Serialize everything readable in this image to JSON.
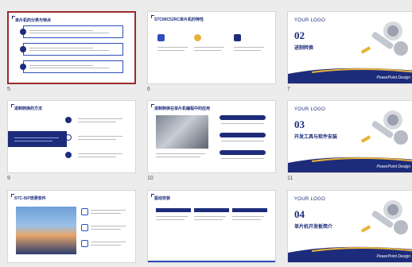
{
  "slides": [
    {
      "number": "5",
      "title": "单片机的分类与特点",
      "selected": true
    },
    {
      "number": "6",
      "title": "STC89C52RC单片机的特性"
    },
    {
      "number": "7",
      "logo": "YOUR LOGO",
      "section_number": "02",
      "section_title": "进制转换",
      "footer": "PowerPoint Design"
    },
    {
      "number": "9",
      "title": "进制转换的方法"
    },
    {
      "number": "10",
      "title": "进制转换在单片机编程中的应用"
    },
    {
      "number": "11",
      "logo": "YOUR LOGO",
      "section_number": "03",
      "section_title": "开发工具与软件安装",
      "footer": "PowerPoint Design"
    },
    {
      "number": "",
      "title": "STC-ISP烧录软件"
    },
    {
      "number": "",
      "title": "驱动安装"
    },
    {
      "number": "",
      "logo": "YOUR LOGO",
      "section_number": "04",
      "section_title": "单片机开发板简介",
      "footer": "PowerPoint Design"
    }
  ],
  "colors": {
    "navy": "#1d2c7a",
    "accent_blue": "#2f4dbd",
    "gold": "#e8b23a",
    "selection": "#9a2a2a"
  }
}
